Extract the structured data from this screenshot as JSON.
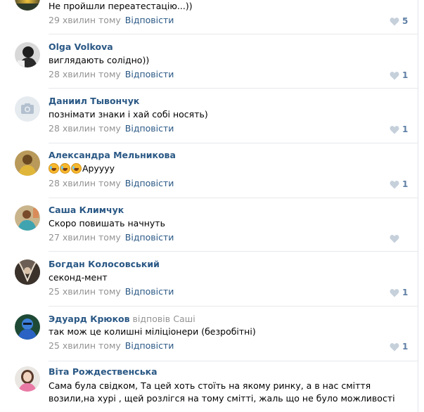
{
  "ui": {
    "reply_action": "Відповісти",
    "heart_icon": "heart-icon",
    "colors": {
      "author": "#2a5885",
      "meta": "#939393",
      "like_count": "#5e7fa5",
      "heart_gray": "#c5d0db",
      "divider": "#e7e8ec"
    }
  },
  "comments": [
    {
      "author": "",
      "text": "Не пройшли переатестацію...))",
      "time": "29 хвилин тому",
      "likes": "5"
    },
    {
      "author": "Olga Volkova",
      "text": "виглядають солідно))",
      "time": "28 хвилин тому",
      "likes": "1"
    },
    {
      "author": "Даниил Тывончук",
      "text": "познімати знаки і хай собі носять)",
      "time": "28 хвилин тому",
      "likes": "1",
      "avatar": "camera-placeholder"
    },
    {
      "author": "Александра Мельникова",
      "text": "Аруууу",
      "emoji_count": 3,
      "time": "28 хвилин тому",
      "likes": "1"
    },
    {
      "author": "Саша Климчук",
      "text": "Скоро повишать начнуть",
      "time": "27 хвилин тому",
      "likes": ""
    },
    {
      "author": "Богдан Колосовський",
      "text": "секонд-мент",
      "time": "25 хвилин тому",
      "likes": "1"
    },
    {
      "author": "Эдуард Крюков",
      "reply_prefix": "відповів",
      "reply_to": "Саші",
      "text": "так мож це колишні міліціонери (безробітні)",
      "time": "25 хвилин тому",
      "likes": "1"
    },
    {
      "author": "Віта Рождественська",
      "text_line1": "Сама була свідком, Та цей хоть стоїть на якому ринку, а в нас сміття",
      "text_line2": "возили,на хурі , щей розлігся на тому смітті, жаль що не було можливості"
    }
  ]
}
